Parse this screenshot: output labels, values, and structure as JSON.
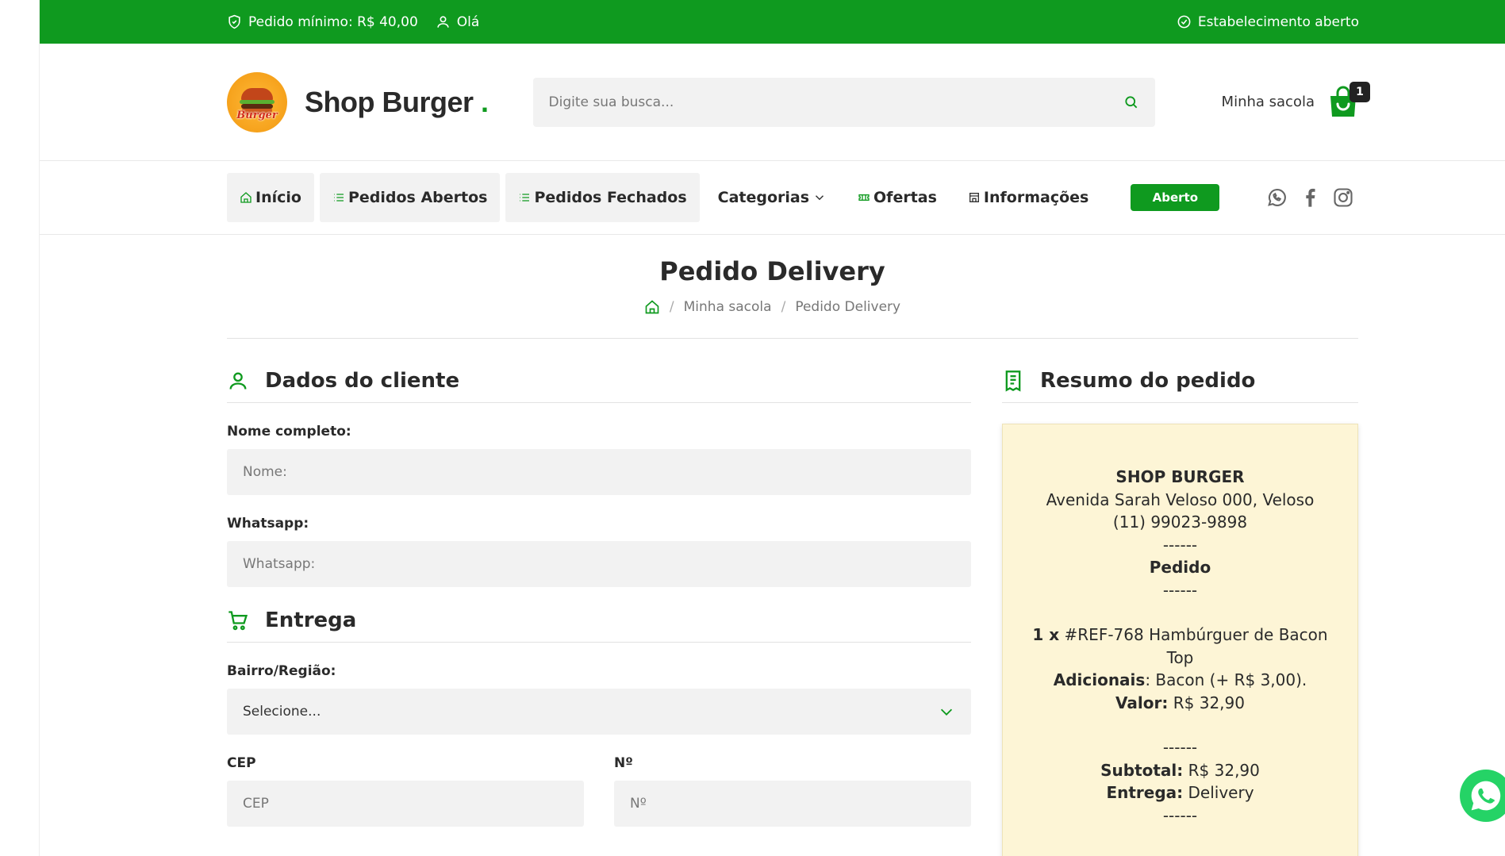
{
  "topbar": {
    "min_order": "Pedido mínimo: R$ 40,00",
    "greeting": "Olá",
    "status": "Estabelecimento aberto"
  },
  "header": {
    "logo_text": "Burger",
    "brand": "Shop Burger",
    "brand_dot": ".",
    "search_placeholder": "Digite sua busca...",
    "bag_label": "Minha sacola",
    "bag_count": "1"
  },
  "nav": {
    "items": [
      {
        "label": "Início"
      },
      {
        "label": "Pedidos Abertos"
      },
      {
        "label": "Pedidos Fechados"
      },
      {
        "label": "Categorias"
      },
      {
        "label": "Ofertas"
      },
      {
        "label": "Informações"
      }
    ],
    "status_button": "Aberto"
  },
  "page": {
    "title": "Pedido Delivery",
    "breadcrumb": [
      "Minha sacola",
      "Pedido Delivery"
    ]
  },
  "customer": {
    "heading": "Dados do cliente",
    "name_label": "Nome completo:",
    "name_placeholder": "Nome:",
    "whatsapp_label": "Whatsapp:",
    "whatsapp_placeholder": "Whatsapp:"
  },
  "delivery": {
    "heading": "Entrega",
    "region_label": "Bairro/Região:",
    "region_value": "Selecione...",
    "cep_label": "CEP",
    "cep_placeholder": "CEP",
    "number_label": "Nº",
    "number_placeholder": "Nº"
  },
  "summary": {
    "heading": "Resumo do pedido",
    "shop_name": "SHOP BURGER",
    "address": "Avenida Sarah Veloso 000, Veloso",
    "phone": "(11) 99023-9898",
    "separator": "------",
    "order_label": "Pedido",
    "item_qty": "1 x",
    "item_desc": "#REF-768 Hambúrguer de Bacon Top",
    "addons_label": "Adicionais",
    "addons_value": ": Bacon (+ R$ 3,00).",
    "value_label": "Valor:",
    "value_amount": "R$ 32,90",
    "subtotal_label": "Subtotal:",
    "subtotal_amount": "R$ 32,90",
    "delivery_label": "Entrega:",
    "delivery_value": "Delivery"
  }
}
